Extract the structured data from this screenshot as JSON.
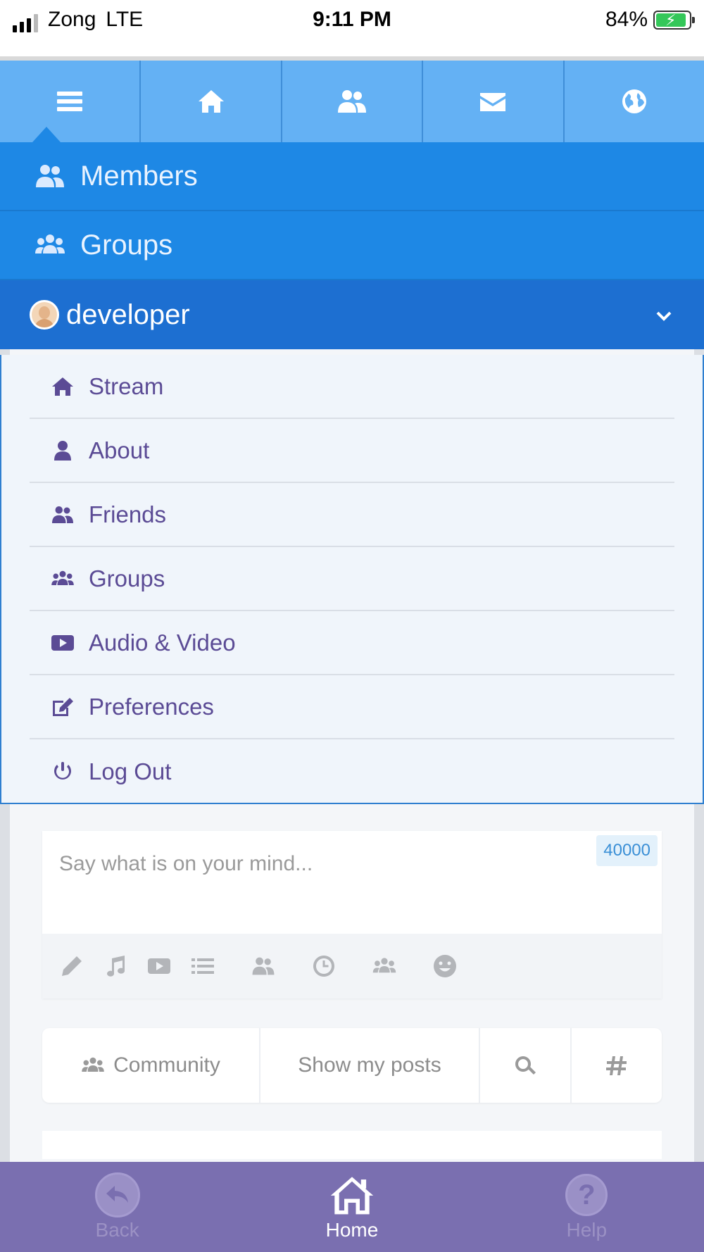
{
  "status_bar": {
    "carrier": "Zong",
    "network": "LTE",
    "time": "9:11 PM",
    "battery_percent": "84%",
    "battery_level": 0.84
  },
  "top_nav": [
    {
      "name": "menu",
      "icon": "hamburger-icon",
      "active": true
    },
    {
      "name": "home",
      "icon": "home-icon"
    },
    {
      "name": "friends",
      "icon": "users-icon"
    },
    {
      "name": "messages",
      "icon": "envelope-icon"
    },
    {
      "name": "network",
      "icon": "globe-icon"
    }
  ],
  "main_menu": {
    "members": "Members",
    "groups": "Groups",
    "profile_name": "developer"
  },
  "profile_menu": {
    "stream": "Stream",
    "about": "About",
    "friends": "Friends",
    "groups": "Groups",
    "audio_video": "Audio & Video",
    "preferences": "Preferences",
    "logout": "Log Out"
  },
  "composer": {
    "placeholder": "Say what is on your mind...",
    "char_counter": "40000",
    "tools": [
      "pencil-icon",
      "music-icon",
      "video-icon",
      "list-icon",
      "users-icon",
      "clock-icon",
      "group-icon",
      "smile-icon"
    ]
  },
  "filters": {
    "community": "Community",
    "my_posts": "Show my posts"
  },
  "bottom_tabs": {
    "back": "Back",
    "home": "Home",
    "help": "Help"
  },
  "colors": {
    "top_nav": "#64b1f4",
    "menu_blue": "#1e88e5",
    "profile_blue": "#1d6fd1",
    "submenu_text": "#5b4b95",
    "tabbar": "#7a6fb0"
  }
}
